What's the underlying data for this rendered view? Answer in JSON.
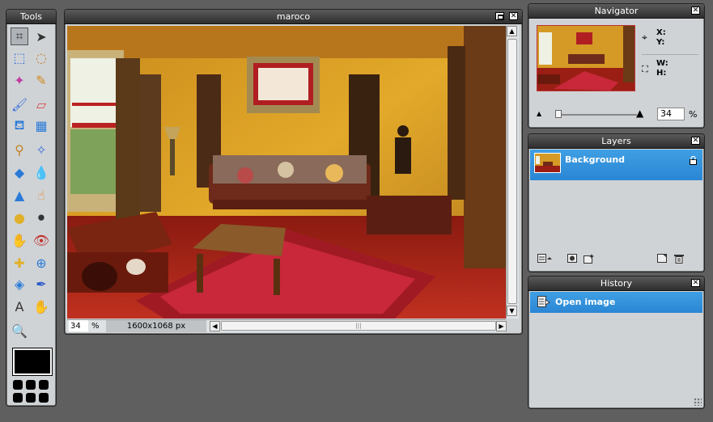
{
  "tools_panel": {
    "title": "Tools",
    "tools": [
      {
        "name": "crop-tool",
        "glyph": "⌗"
      },
      {
        "name": "move-tool",
        "glyph": "➤"
      },
      {
        "name": "marquee-tool",
        "glyph": "⬚"
      },
      {
        "name": "lasso-tool",
        "glyph": "◌"
      },
      {
        "name": "magic-wand-tool",
        "glyph": "✦"
      },
      {
        "name": "pencil-tool",
        "glyph": "✎"
      },
      {
        "name": "brush-tool",
        "glyph": "🖌"
      },
      {
        "name": "eraser-tool",
        "glyph": "▱"
      },
      {
        "name": "paint-bucket-tool",
        "glyph": "⛾"
      },
      {
        "name": "gradient-tool",
        "glyph": "▦"
      },
      {
        "name": "clone-stamp-tool",
        "glyph": "⚲"
      },
      {
        "name": "color-replace-tool",
        "glyph": "✧"
      },
      {
        "name": "drawing-shapes-tool",
        "glyph": "◆"
      },
      {
        "name": "blur-tool",
        "glyph": "💧"
      },
      {
        "name": "sharpen-tool",
        "glyph": "▲"
      },
      {
        "name": "smudge-tool",
        "glyph": "☝"
      },
      {
        "name": "sponge-tool",
        "glyph": "●"
      },
      {
        "name": "dodge-tool",
        "glyph": "⚫"
      },
      {
        "name": "burn-tool",
        "glyph": "✋"
      },
      {
        "name": "red-eye-tool",
        "glyph": "👁"
      },
      {
        "name": "spot-heal-tool",
        "glyph": "✚"
      },
      {
        "name": "bloat-tool",
        "glyph": "⊕"
      },
      {
        "name": "pinch-tool",
        "glyph": "◈"
      },
      {
        "name": "color-picker-tool",
        "glyph": "✒"
      },
      {
        "name": "type-tool",
        "glyph": "A"
      },
      {
        "name": "hand-tool",
        "glyph": "✋"
      },
      {
        "name": "zoom-tool",
        "glyph": "🔍"
      }
    ]
  },
  "image_window": {
    "title": "maroco",
    "zoom": "34",
    "zoom_unit": "%",
    "image_size": "1600x1068 px"
  },
  "navigator": {
    "title": "Navigator",
    "x_label": "X:",
    "y_label": "Y:",
    "w_label": "W:",
    "h_label": "H:",
    "zoom_value": "34",
    "zoom_unit": "%",
    "zoom_level": 0.34
  },
  "layers": {
    "title": "Layers",
    "items": [
      {
        "label": "Background",
        "locked": true
      }
    ]
  },
  "history": {
    "title": "History",
    "items": [
      {
        "label": "Open image"
      }
    ]
  },
  "colors": {
    "panel_bg": "#cfd3d6",
    "selection": "#2a86d5",
    "titlebar": "#3a3a3a",
    "workspace": "#5f5f5f"
  }
}
